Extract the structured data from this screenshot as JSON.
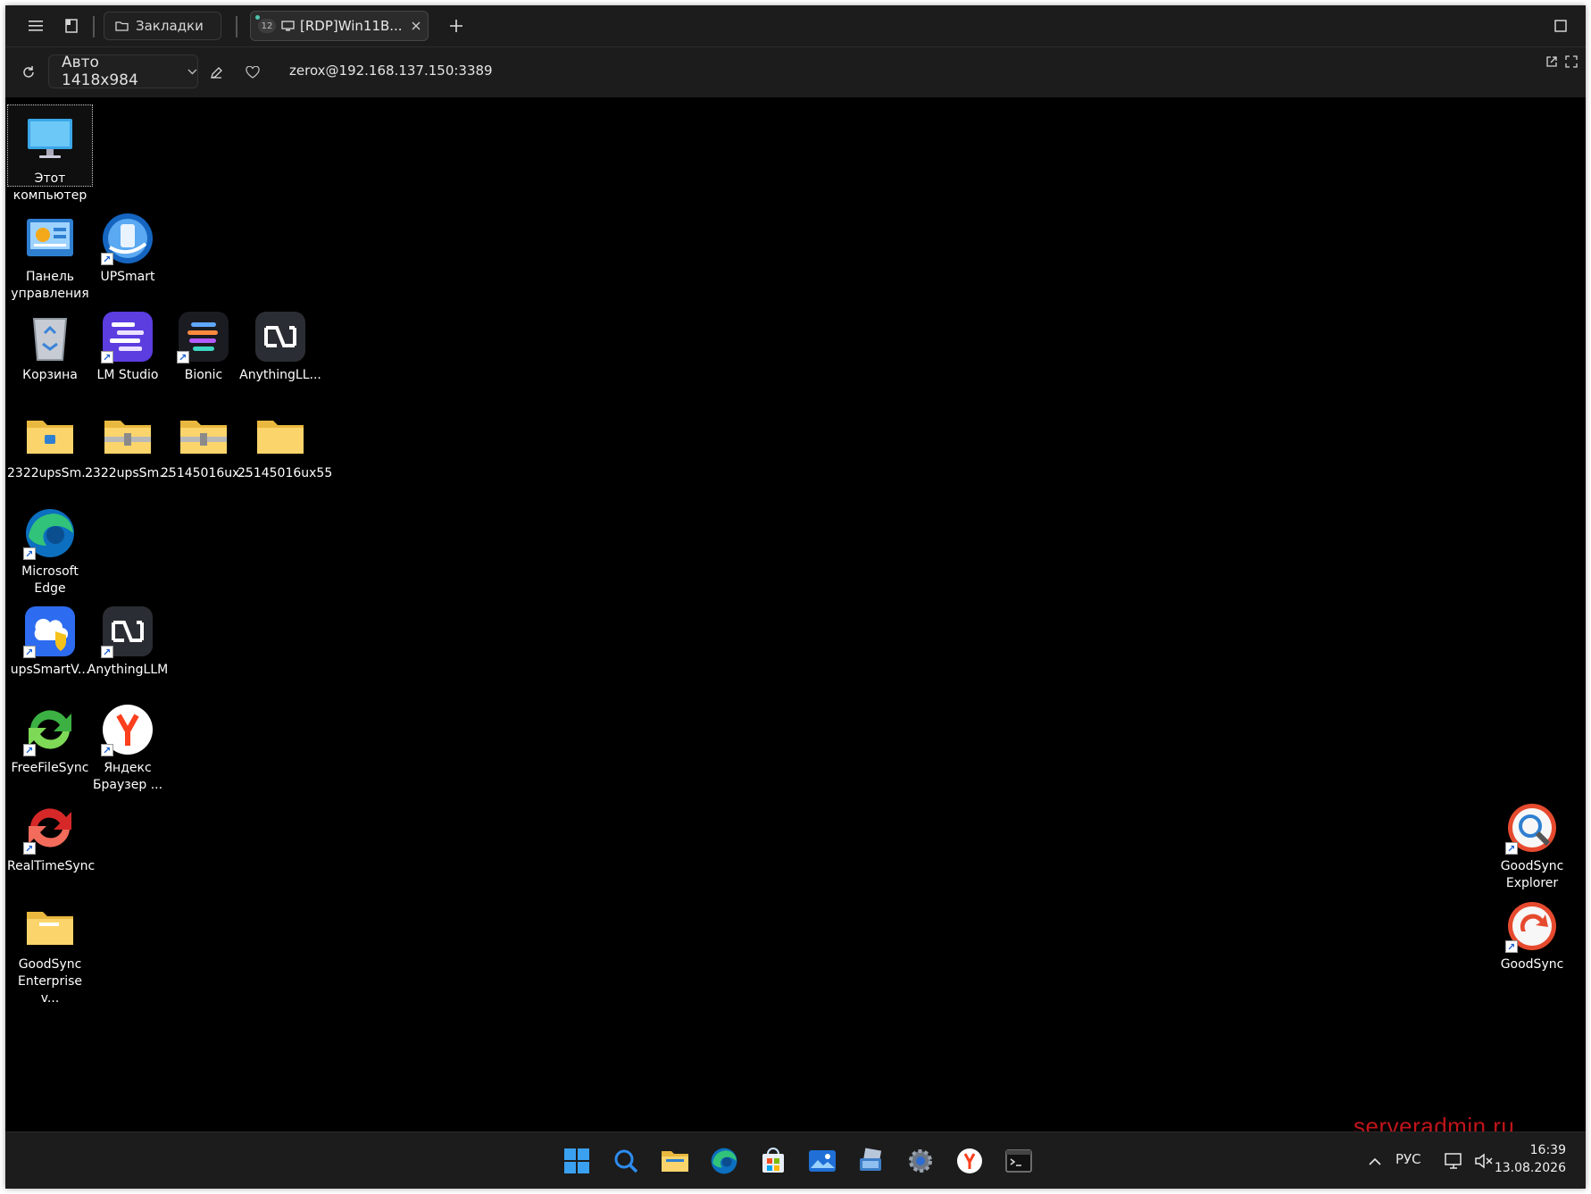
{
  "toolbar": {
    "bookmarks_label": "Закладки",
    "tab_count": "12",
    "tab_title": "[RDP]Win11B...",
    "resolution_label": "Авто 1418x984",
    "address": "zerox@192.168.137.150:3389"
  },
  "desktop": {
    "icons": [
      {
        "label": "Этот компьютер"
      },
      {
        "label": "Панель управления"
      },
      {
        "label": "UPSmart"
      },
      {
        "label": "Корзина"
      },
      {
        "label": "LM Studio"
      },
      {
        "label": "Bionic"
      },
      {
        "label": "AnythingLL..."
      },
      {
        "label": "2322upsSm..."
      },
      {
        "label": "2322upsSm..."
      },
      {
        "label": "25145016ux..."
      },
      {
        "label": "25145016ux55"
      },
      {
        "label": "Microsoft Edge"
      },
      {
        "label": "upsSmartV..."
      },
      {
        "label": "AnythingLLM"
      },
      {
        "label": "FreeFileSync"
      },
      {
        "label": "Яндекс Браузер ..."
      },
      {
        "label": "RealTimeSync"
      },
      {
        "label": "GoodSync Enterprise v..."
      },
      {
        "label": "GoodSync Explorer"
      },
      {
        "label": "GoodSync"
      }
    ],
    "watermark": "serveradmin.ru"
  },
  "taskbar": {
    "apps": [
      "start-icon",
      "search-icon",
      "file-explorer-icon",
      "edge-icon",
      "store-icon",
      "photos-icon",
      "remote-desktop-icon",
      "settings-icon",
      "yandex-browser-icon",
      "terminal-icon"
    ],
    "language": "РУС",
    "time": "16:39",
    "date": "13.08.2026"
  }
}
